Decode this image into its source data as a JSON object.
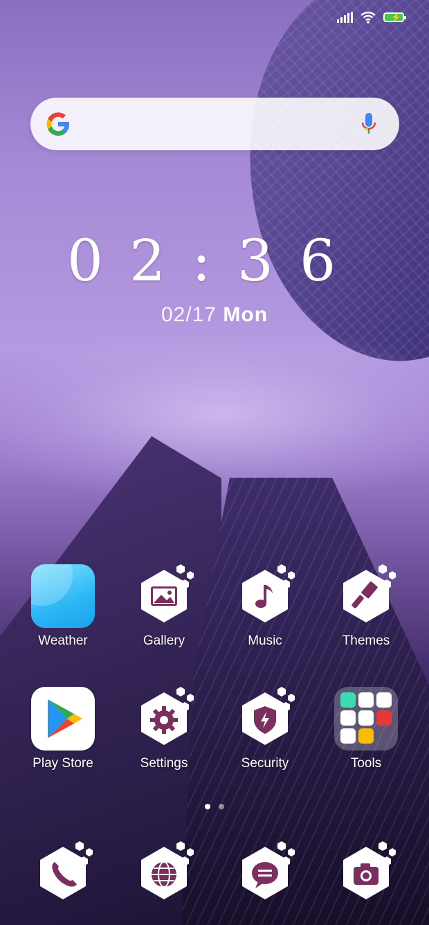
{
  "status_bar": {
    "icons": [
      "signal-icon",
      "wifi-icon",
      "battery-charging-icon"
    ]
  },
  "search": {
    "icons": [
      "google-g-icon",
      "microphone-icon"
    ]
  },
  "clock": {
    "time": "02:36",
    "date_num": "02/17",
    "date_day": "Mon"
  },
  "apps_row1": [
    {
      "label": "Weather",
      "icon": "weather-icon"
    },
    {
      "label": "Gallery",
      "icon": "gallery-icon"
    },
    {
      "label": "Music",
      "icon": "music-note-icon"
    },
    {
      "label": "Themes",
      "icon": "paintbrush-icon"
    }
  ],
  "apps_row2": [
    {
      "label": "Play Store",
      "icon": "play-store-icon"
    },
    {
      "label": "Settings",
      "icon": "gear-icon"
    },
    {
      "label": "Security",
      "icon": "shield-icon"
    },
    {
      "label": "Tools",
      "icon": "folder-icon"
    }
  ],
  "dock": [
    {
      "icon": "phone-icon"
    },
    {
      "icon": "globe-icon"
    },
    {
      "icon": "message-icon"
    },
    {
      "icon": "camera-icon"
    }
  ],
  "page_indicator": {
    "pages": 2,
    "current": 1
  },
  "colors": {
    "hex_icon_fg": "#7a2f5e",
    "hex_icon_bg": "#ffffff",
    "battery": "#48c84a"
  }
}
